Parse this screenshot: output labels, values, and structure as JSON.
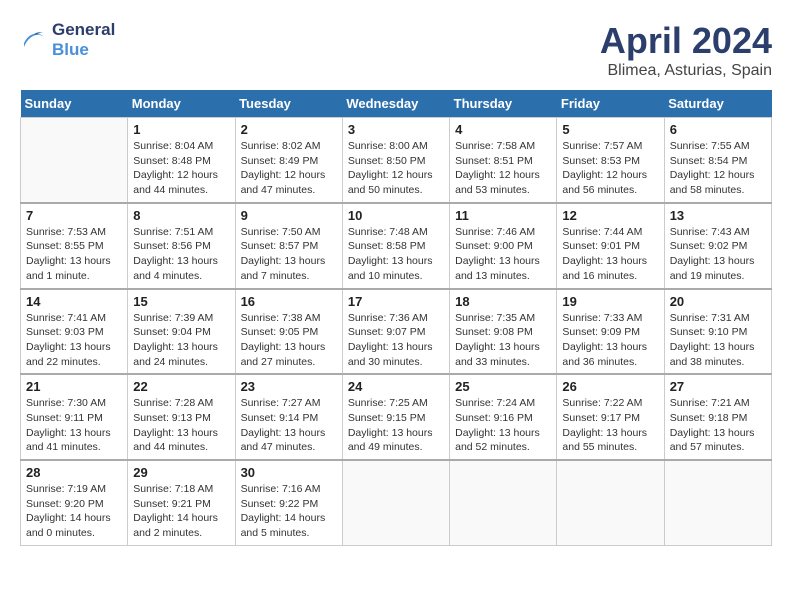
{
  "logo": {
    "line1": "General",
    "line2": "Blue"
  },
  "title": "April 2024",
  "subtitle": "Blimea, Asturias, Spain",
  "calendar": {
    "headers": [
      "Sunday",
      "Monday",
      "Tuesday",
      "Wednesday",
      "Thursday",
      "Friday",
      "Saturday"
    ],
    "weeks": [
      [
        {
          "num": "",
          "sunrise": "",
          "sunset": "",
          "daylight": ""
        },
        {
          "num": "1",
          "sunrise": "Sunrise: 8:04 AM",
          "sunset": "Sunset: 8:48 PM",
          "daylight": "Daylight: 12 hours and 44 minutes."
        },
        {
          "num": "2",
          "sunrise": "Sunrise: 8:02 AM",
          "sunset": "Sunset: 8:49 PM",
          "daylight": "Daylight: 12 hours and 47 minutes."
        },
        {
          "num": "3",
          "sunrise": "Sunrise: 8:00 AM",
          "sunset": "Sunset: 8:50 PM",
          "daylight": "Daylight: 12 hours and 50 minutes."
        },
        {
          "num": "4",
          "sunrise": "Sunrise: 7:58 AM",
          "sunset": "Sunset: 8:51 PM",
          "daylight": "Daylight: 12 hours and 53 minutes."
        },
        {
          "num": "5",
          "sunrise": "Sunrise: 7:57 AM",
          "sunset": "Sunset: 8:53 PM",
          "daylight": "Daylight: 12 hours and 56 minutes."
        },
        {
          "num": "6",
          "sunrise": "Sunrise: 7:55 AM",
          "sunset": "Sunset: 8:54 PM",
          "daylight": "Daylight: 12 hours and 58 minutes."
        }
      ],
      [
        {
          "num": "7",
          "sunrise": "Sunrise: 7:53 AM",
          "sunset": "Sunset: 8:55 PM",
          "daylight": "Daylight: 13 hours and 1 minute."
        },
        {
          "num": "8",
          "sunrise": "Sunrise: 7:51 AM",
          "sunset": "Sunset: 8:56 PM",
          "daylight": "Daylight: 13 hours and 4 minutes."
        },
        {
          "num": "9",
          "sunrise": "Sunrise: 7:50 AM",
          "sunset": "Sunset: 8:57 PM",
          "daylight": "Daylight: 13 hours and 7 minutes."
        },
        {
          "num": "10",
          "sunrise": "Sunrise: 7:48 AM",
          "sunset": "Sunset: 8:58 PM",
          "daylight": "Daylight: 13 hours and 10 minutes."
        },
        {
          "num": "11",
          "sunrise": "Sunrise: 7:46 AM",
          "sunset": "Sunset: 9:00 PM",
          "daylight": "Daylight: 13 hours and 13 minutes."
        },
        {
          "num": "12",
          "sunrise": "Sunrise: 7:44 AM",
          "sunset": "Sunset: 9:01 PM",
          "daylight": "Daylight: 13 hours and 16 minutes."
        },
        {
          "num": "13",
          "sunrise": "Sunrise: 7:43 AM",
          "sunset": "Sunset: 9:02 PM",
          "daylight": "Daylight: 13 hours and 19 minutes."
        }
      ],
      [
        {
          "num": "14",
          "sunrise": "Sunrise: 7:41 AM",
          "sunset": "Sunset: 9:03 PM",
          "daylight": "Daylight: 13 hours and 22 minutes."
        },
        {
          "num": "15",
          "sunrise": "Sunrise: 7:39 AM",
          "sunset": "Sunset: 9:04 PM",
          "daylight": "Daylight: 13 hours and 24 minutes."
        },
        {
          "num": "16",
          "sunrise": "Sunrise: 7:38 AM",
          "sunset": "Sunset: 9:05 PM",
          "daylight": "Daylight: 13 hours and 27 minutes."
        },
        {
          "num": "17",
          "sunrise": "Sunrise: 7:36 AM",
          "sunset": "Sunset: 9:07 PM",
          "daylight": "Daylight: 13 hours and 30 minutes."
        },
        {
          "num": "18",
          "sunrise": "Sunrise: 7:35 AM",
          "sunset": "Sunset: 9:08 PM",
          "daylight": "Daylight: 13 hours and 33 minutes."
        },
        {
          "num": "19",
          "sunrise": "Sunrise: 7:33 AM",
          "sunset": "Sunset: 9:09 PM",
          "daylight": "Daylight: 13 hours and 36 minutes."
        },
        {
          "num": "20",
          "sunrise": "Sunrise: 7:31 AM",
          "sunset": "Sunset: 9:10 PM",
          "daylight": "Daylight: 13 hours and 38 minutes."
        }
      ],
      [
        {
          "num": "21",
          "sunrise": "Sunrise: 7:30 AM",
          "sunset": "Sunset: 9:11 PM",
          "daylight": "Daylight: 13 hours and 41 minutes."
        },
        {
          "num": "22",
          "sunrise": "Sunrise: 7:28 AM",
          "sunset": "Sunset: 9:13 PM",
          "daylight": "Daylight: 13 hours and 44 minutes."
        },
        {
          "num": "23",
          "sunrise": "Sunrise: 7:27 AM",
          "sunset": "Sunset: 9:14 PM",
          "daylight": "Daylight: 13 hours and 47 minutes."
        },
        {
          "num": "24",
          "sunrise": "Sunrise: 7:25 AM",
          "sunset": "Sunset: 9:15 PM",
          "daylight": "Daylight: 13 hours and 49 minutes."
        },
        {
          "num": "25",
          "sunrise": "Sunrise: 7:24 AM",
          "sunset": "Sunset: 9:16 PM",
          "daylight": "Daylight: 13 hours and 52 minutes."
        },
        {
          "num": "26",
          "sunrise": "Sunrise: 7:22 AM",
          "sunset": "Sunset: 9:17 PM",
          "daylight": "Daylight: 13 hours and 55 minutes."
        },
        {
          "num": "27",
          "sunrise": "Sunrise: 7:21 AM",
          "sunset": "Sunset: 9:18 PM",
          "daylight": "Daylight: 13 hours and 57 minutes."
        }
      ],
      [
        {
          "num": "28",
          "sunrise": "Sunrise: 7:19 AM",
          "sunset": "Sunset: 9:20 PM",
          "daylight": "Daylight: 14 hours and 0 minutes."
        },
        {
          "num": "29",
          "sunrise": "Sunrise: 7:18 AM",
          "sunset": "Sunset: 9:21 PM",
          "daylight": "Daylight: 14 hours and 2 minutes."
        },
        {
          "num": "30",
          "sunrise": "Sunrise: 7:16 AM",
          "sunset": "Sunset: 9:22 PM",
          "daylight": "Daylight: 14 hours and 5 minutes."
        },
        {
          "num": "",
          "sunrise": "",
          "sunset": "",
          "daylight": ""
        },
        {
          "num": "",
          "sunrise": "",
          "sunset": "",
          "daylight": ""
        },
        {
          "num": "",
          "sunrise": "",
          "sunset": "",
          "daylight": ""
        },
        {
          "num": "",
          "sunrise": "",
          "sunset": "",
          "daylight": ""
        }
      ]
    ]
  }
}
